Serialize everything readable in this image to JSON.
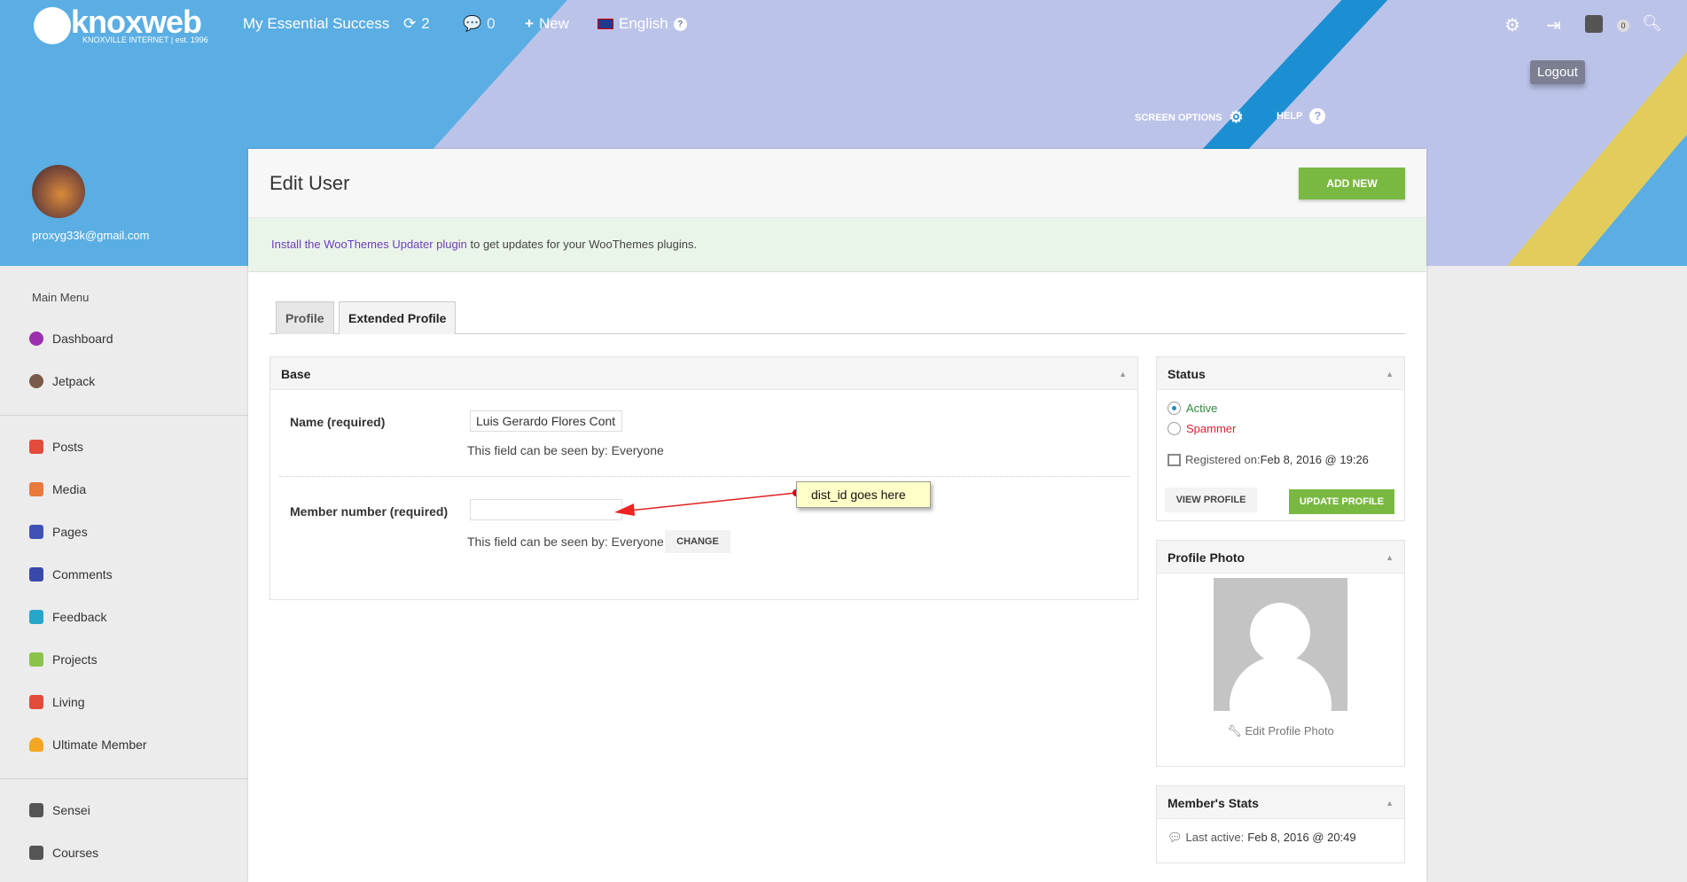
{
  "topbar": {
    "logo_text": "knoxweb",
    "logo_sub": "KNOXVILLE INTERNET | est. 1996",
    "site_name": "My Essential Success",
    "updates_count": "2",
    "comments_count": "0",
    "new_label": "New",
    "language": "English",
    "notif_count": "0",
    "logout_tooltip": "Logout"
  },
  "screen_options": "SCREEN OPTIONS",
  "help": "HELP",
  "user": {
    "email": "proxyg33k@gmail.com"
  },
  "sidebar": {
    "heading": "Main Menu",
    "items": [
      {
        "label": "Dashboard",
        "color": "#9b2fae"
      },
      {
        "label": "Jetpack",
        "color": "#7a5a4a"
      },
      {
        "label": "Posts",
        "color": "#e34b3a"
      },
      {
        "label": "Media",
        "color": "#e8793a"
      },
      {
        "label": "Pages",
        "color": "#3f51b5"
      },
      {
        "label": "Comments",
        "color": "#3949ab"
      },
      {
        "label": "Feedback",
        "color": "#26a6c9"
      },
      {
        "label": "Projects",
        "color": "#8bc34a"
      },
      {
        "label": "Living",
        "color": "#e34b3a"
      },
      {
        "label": "Ultimate Member",
        "color": "#f5a623"
      },
      {
        "label": "Sensei",
        "color": "#555555"
      },
      {
        "label": "Courses",
        "color": "#555555"
      }
    ]
  },
  "page": {
    "title": "Edit User",
    "add_new": "ADD NEW",
    "notice_link": "Install the WooThemes Updater plugin",
    "notice_text": " to get updates for your WooThemes plugins.",
    "tabs": [
      {
        "label": "Profile"
      },
      {
        "label": "Extended Profile"
      }
    ]
  },
  "base": {
    "title": "Base",
    "name_label": "Name (required)",
    "name_value": "Luis Gerardo Flores Contr",
    "name_visibility": "This field can be seen by: Everyone",
    "member_label": "Member number (required)",
    "member_value": "",
    "member_visibility": "This field can be seen by: Everyone",
    "change": "CHANGE",
    "annotation": "dist_id goes here"
  },
  "status": {
    "title": "Status",
    "active": "Active",
    "spammer": "Spammer",
    "registered_label": "Registered on: ",
    "registered_value": "Feb 8, 2016 @ 19:26",
    "view_profile": "VIEW PROFILE",
    "update_profile": "UPDATE PROFILE"
  },
  "photo": {
    "title": "Profile Photo",
    "edit": "Edit Profile Photo"
  },
  "stats": {
    "title": "Member's Stats",
    "last_active_label": "Last active: ",
    "last_active_value": "Feb 8, 2016 @ 20:49"
  }
}
